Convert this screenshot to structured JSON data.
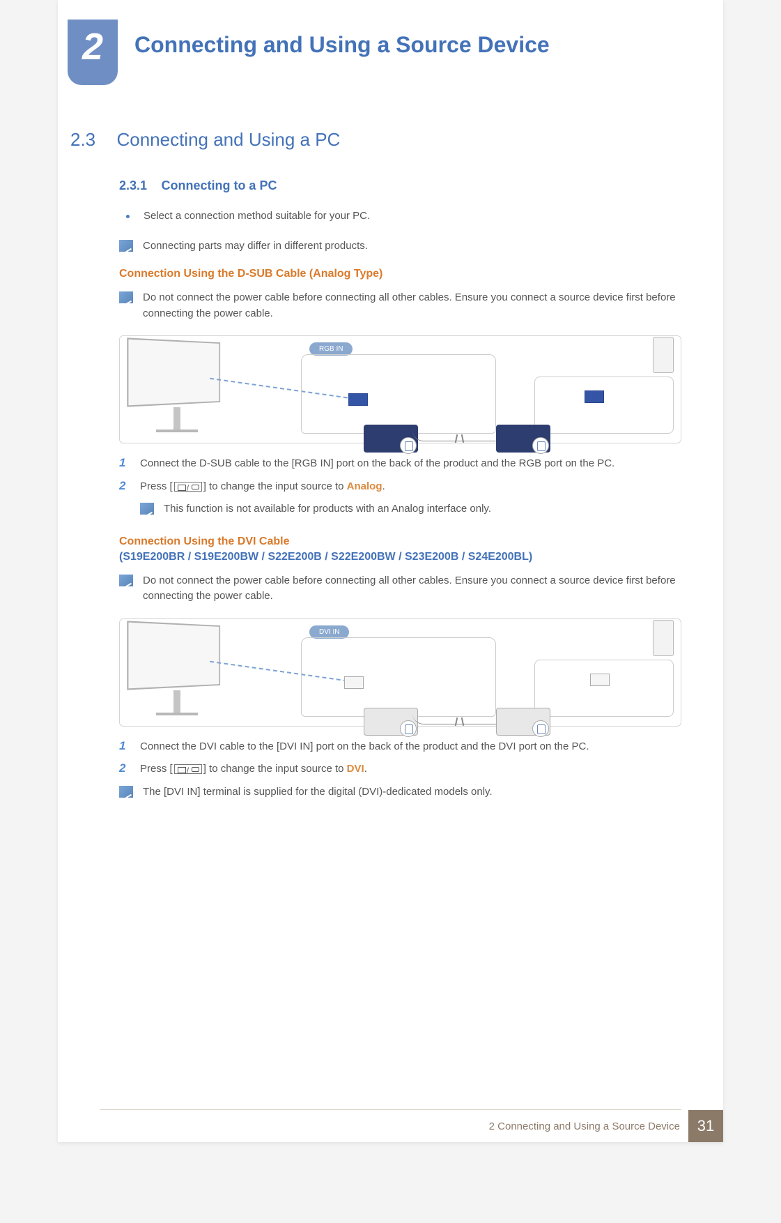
{
  "chapter": {
    "num": "2",
    "title": "Connecting and Using a Source Device"
  },
  "section": {
    "num": "2.3",
    "title": "Connecting and Using a PC"
  },
  "subsection": {
    "num": "2.3.1",
    "title": "Connecting to a PC"
  },
  "bullet": "Select a connection method suitable for your PC.",
  "note_products": "Connecting parts may differ in different products.",
  "dsub": {
    "heading": "Connection Using the D-SUB Cable (Analog Type)",
    "warn": "Do not connect the power cable before connecting all other cables. Ensure you connect a source device first before connecting the power cable.",
    "port_label": "RGB IN",
    "step1": "Connect the D-SUB cable to the [RGB IN] port on the back of the product and the RGB port on the PC.",
    "step2_a": "Press [",
    "step2_b": "] to change the input source to ",
    "step2_kw": "Analog",
    "step2_c": ".",
    "note2": "This function is not available for products with an Analog interface only."
  },
  "dvi": {
    "heading": "Connection Using the DVI Cable",
    "models": "(S19E200BR / S19E200BW / S22E200B / S22E200BW / S23E200B / S24E200BL)",
    "warn": "Do not connect the power cable before connecting all other cables. Ensure you connect a source device first before connecting the power cable.",
    "port_label": "DVI IN",
    "step1": "Connect the DVI cable to the [DVI IN] port on the back of the product and the DVI port on the PC.",
    "step2_a": "Press [",
    "step2_b": "] to change the input source to ",
    "step2_kw": "DVI",
    "step2_c": ".",
    "note2": "The [DVI IN] terminal is supplied for the digital (DVI)-dedicated models only."
  },
  "footer": {
    "title": "2 Connecting and Using a Source Device",
    "page": "31"
  }
}
